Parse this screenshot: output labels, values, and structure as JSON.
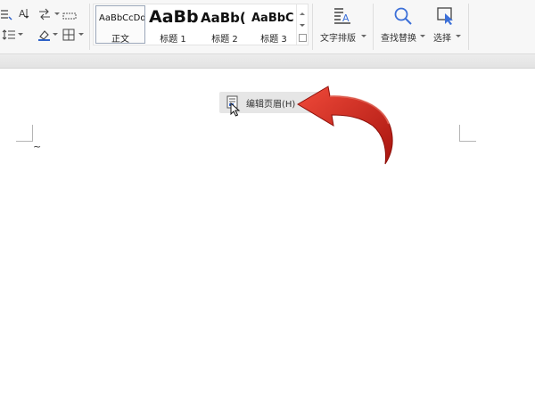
{
  "styles": {
    "normal": {
      "preview": "AaBbCcDd",
      "label": "正文"
    },
    "h1": {
      "preview": "AaBb",
      "label": "标题 1"
    },
    "h2": {
      "preview": "AaBb(",
      "label": "标题 2"
    },
    "h3": {
      "preview": "AaBbC",
      "label": "标题 3"
    }
  },
  "toolbar": {
    "text_layout_label": "文字排版",
    "find_replace_label": "查找替换",
    "select_label": "选择"
  },
  "context_menu": {
    "edit_header_label": "编辑页眉(H)"
  },
  "document": {
    "cursor_text": "~"
  },
  "colors": {
    "accent": "#3b6fd8",
    "arrow_red": "#d7261c",
    "ribbon_bg": "#f7f7f7"
  }
}
